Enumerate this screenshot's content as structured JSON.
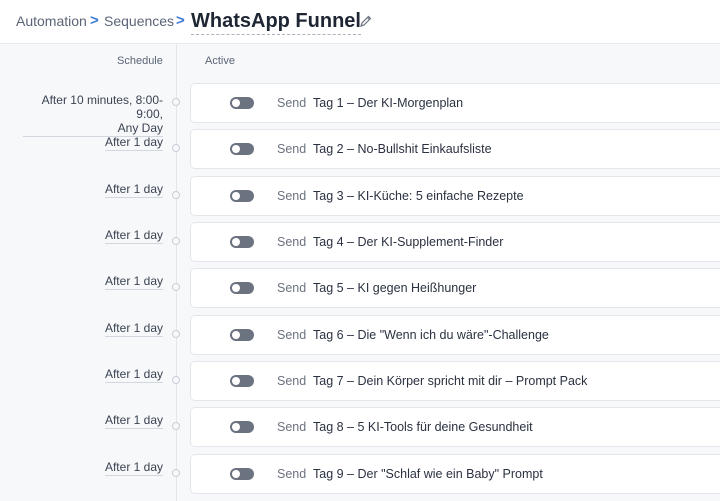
{
  "breadcrumb": {
    "items": [
      "Automation",
      "Sequences"
    ],
    "separator": ">",
    "title": "WhatsApp Funnel",
    "edit_icon": "pencil-icon"
  },
  "columns": {
    "schedule": "Schedule",
    "active": "Active"
  },
  "colors": {
    "accent": "#3a7bd5",
    "toggle_off": "#6b7280"
  },
  "steps": [
    {
      "schedule": [
        "After 10 minutes, 8:00-",
        "9:00,",
        "Any Day"
      ],
      "send": "Send",
      "message": "Tag 1 – Der KI-Morgenplan",
      "active": false
    },
    {
      "schedule": [
        "After 1 day"
      ],
      "send": "Send",
      "message": "Tag 2 – No-Bullshit Einkaufsliste",
      "active": false
    },
    {
      "schedule": [
        "After 1 day"
      ],
      "send": "Send",
      "message": "Tag 3 – KI-Küche: 5 einfache Rezepte",
      "active": false
    },
    {
      "schedule": [
        "After 1 day"
      ],
      "send": "Send",
      "message": "Tag 4 – Der KI-Supplement-Finder",
      "active": false
    },
    {
      "schedule": [
        "After 1 day"
      ],
      "send": "Send",
      "message": "Tag 5 – KI gegen Heißhunger",
      "active": false
    },
    {
      "schedule": [
        "After 1 day"
      ],
      "send": "Send",
      "message": "Tag 6 – Die \"Wenn ich du wäre\"-Challenge",
      "active": false
    },
    {
      "schedule": [
        "After 1 day"
      ],
      "send": "Send",
      "message": "Tag 7 – Dein Körper spricht mit dir – Prompt Pack",
      "active": false
    },
    {
      "schedule": [
        "After 1 day"
      ],
      "send": "Send",
      "message": "Tag 8 – 5 KI-Tools für deine Gesundheit",
      "active": false
    },
    {
      "schedule": [
        "After 1 day"
      ],
      "send": "Send",
      "message": "Tag 9 – Der \"Schlaf wie ein Baby\" Prompt",
      "active": false
    }
  ]
}
